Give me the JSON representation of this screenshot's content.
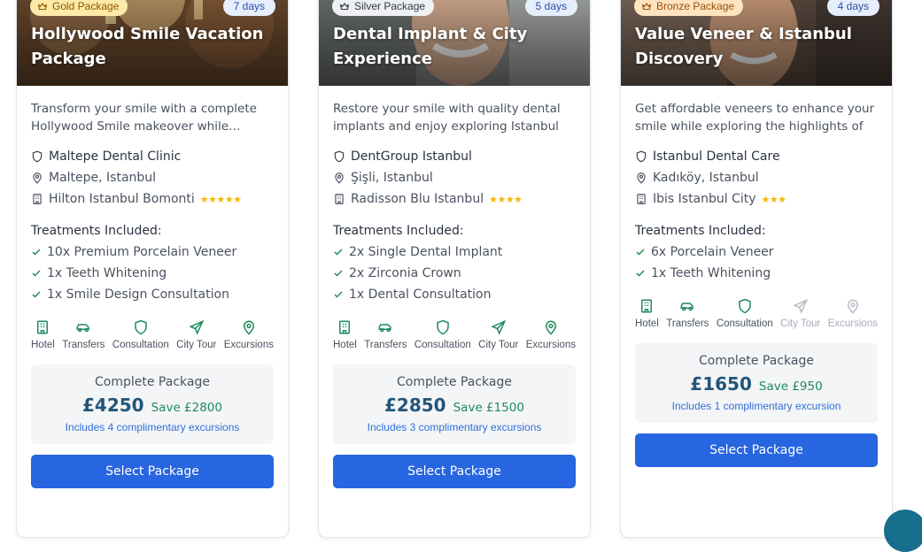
{
  "packages": [
    {
      "tier": "Gold Package",
      "days": "7 days",
      "title": "Hollywood Smile Vacation Package",
      "description": "Transform your smile with a complete Hollywood Smile makeover while enjoying",
      "clinic": "Maltepe Dental Clinic",
      "location": "Maltepe, Istanbul",
      "hotel": "Hilton Istanbul Bomonti",
      "hotel_stars": "★★★★★",
      "stars_count": 5,
      "treatments_heading": "Treatments Included:",
      "treatments": [
        "10x Premium Porcelain Veneer",
        "1x Teeth Whitening",
        "1x Smile Design Consultation"
      ],
      "features": [
        {
          "label": "Hotel",
          "icon": "hotel-icon",
          "active": true
        },
        {
          "label": "Transfers",
          "icon": "car-icon",
          "active": true
        },
        {
          "label": "Consultation",
          "icon": "shield-icon",
          "active": true
        },
        {
          "label": "City Tour",
          "icon": "plane-icon",
          "active": true
        },
        {
          "label": "Excursions",
          "icon": "map-pin-icon",
          "active": true
        }
      ],
      "price_label": "Complete Package",
      "price": "£4250",
      "save": "Save £2800",
      "note": "Includes 4 complimentary excursions",
      "button": "Select Package"
    },
    {
      "tier": "Silver Package",
      "days": "5 days",
      "title": "Dental Implant & City Experience",
      "description": "Restore your smile with quality dental implants and enjoy exploring Istanbul",
      "clinic": "DentGroup Istanbul",
      "location": "Şişli, Istanbul",
      "hotel": "Radisson Blu Istanbul",
      "hotel_stars": "★★★★",
      "stars_count": 4,
      "treatments_heading": "Treatments Included:",
      "treatments": [
        "2x Single Dental Implant",
        "2x Zirconia Crown",
        "1x Dental Consultation"
      ],
      "features": [
        {
          "label": "Hotel",
          "icon": "hotel-icon",
          "active": true
        },
        {
          "label": "Transfers",
          "icon": "car-icon",
          "active": true
        },
        {
          "label": "Consultation",
          "icon": "shield-icon",
          "active": true
        },
        {
          "label": "City Tour",
          "icon": "plane-icon",
          "active": true
        },
        {
          "label": "Excursions",
          "icon": "map-pin-icon",
          "active": true
        }
      ],
      "price_label": "Complete Package",
      "price": "£2850",
      "save": "Save £1500",
      "note": "Includes 3 complimentary excursions",
      "button": "Select Package"
    },
    {
      "tier": "Bronze Package",
      "days": "4 days",
      "title": "Value Veneer & Istanbul Discovery",
      "description": "Get affordable veneers to enhance your smile while exploring the highlights of",
      "clinic": "Istanbul Dental Care",
      "location": "Kadıköy, Istanbul",
      "hotel": "Ibis Istanbul City",
      "hotel_stars": "★★★",
      "stars_count": 3,
      "treatments_heading": "Treatments Included:",
      "treatments": [
        "6x Porcelain Veneer",
        "1x Teeth Whitening"
      ],
      "features": [
        {
          "label": "Hotel",
          "icon": "hotel-icon",
          "active": true
        },
        {
          "label": "Transfers",
          "icon": "car-icon",
          "active": true
        },
        {
          "label": "Consultation",
          "icon": "shield-icon",
          "active": true
        },
        {
          "label": "City Tour",
          "icon": "plane-icon",
          "active": false
        },
        {
          "label": "Excursions",
          "icon": "map-pin-icon",
          "active": false
        }
      ],
      "price_label": "Complete Package",
      "price": "£1650",
      "save": "Save £950",
      "note": "Includes 1 complimentary excursion",
      "button": "Select Package"
    }
  ],
  "colors": {
    "gold_badge_bg": "#fde9a8",
    "gold_badge_fg": "#8a5a00",
    "silver_badge_bg": "#eef0f3",
    "silver_badge_fg": "#333a44",
    "bronze_badge_bg": "#fde4bf",
    "bronze_badge_fg": "#9a4f0a",
    "accent_green": "#1f8a5c",
    "price_blue": "#22567a",
    "button_blue": "#2865e0",
    "star": "#f5b800"
  }
}
